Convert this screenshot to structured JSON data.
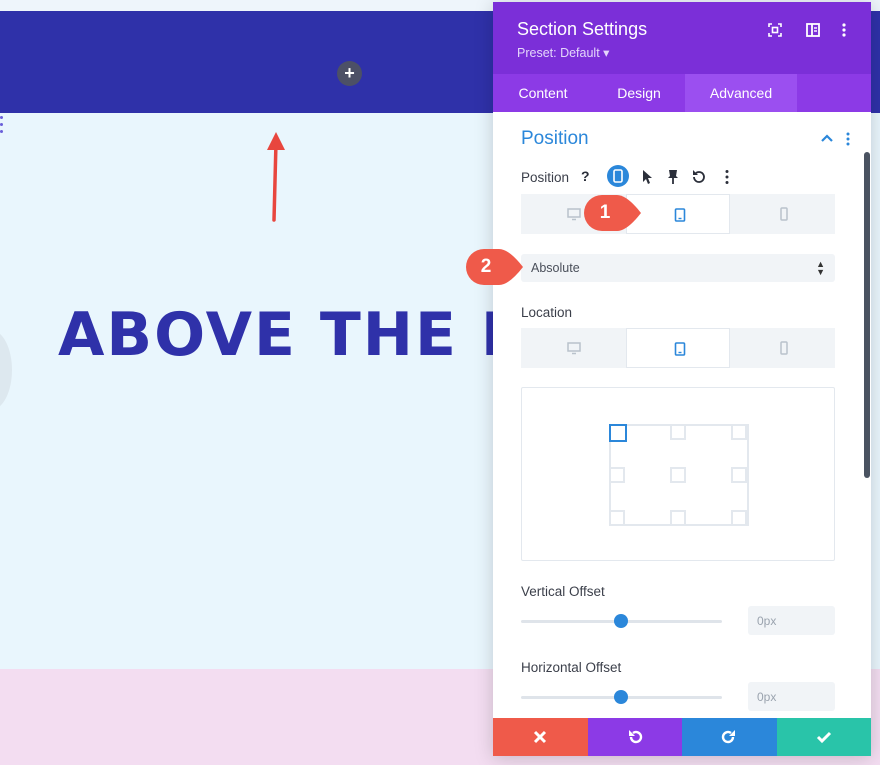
{
  "page": {
    "add_button": "+",
    "hero_title": "ABOVE THE F"
  },
  "modal": {
    "title": "Section Settings",
    "preset": "Preset: Default ▾",
    "tabs": [
      {
        "label": "Content",
        "active": false
      },
      {
        "label": "Design",
        "active": false
      },
      {
        "label": "Advanced",
        "active": true
      }
    ],
    "section": {
      "title": "Position",
      "position_label": "Position",
      "help_symbol": "?",
      "select_value": "Absolute",
      "location_label": "Location",
      "vertical_offset_label": "Vertical Offset",
      "vertical_offset_value": "0px",
      "horizontal_offset_label": "Horizontal Offset",
      "horizontal_offset_value": "0px"
    }
  },
  "callouts": [
    {
      "number": "1",
      "color": "#ef5a4a"
    },
    {
      "number": "2",
      "color": "#ef5a4a"
    }
  ],
  "colors": {
    "header_purple": "#7b2fd8",
    "accent_blue": "#2b87da",
    "cancel_red": "#ef5a4a",
    "undo_purple": "#8c3ae6",
    "redo_blue": "#2b87da",
    "save_green": "#29c4a9",
    "section_navy": "#2f31a9"
  }
}
